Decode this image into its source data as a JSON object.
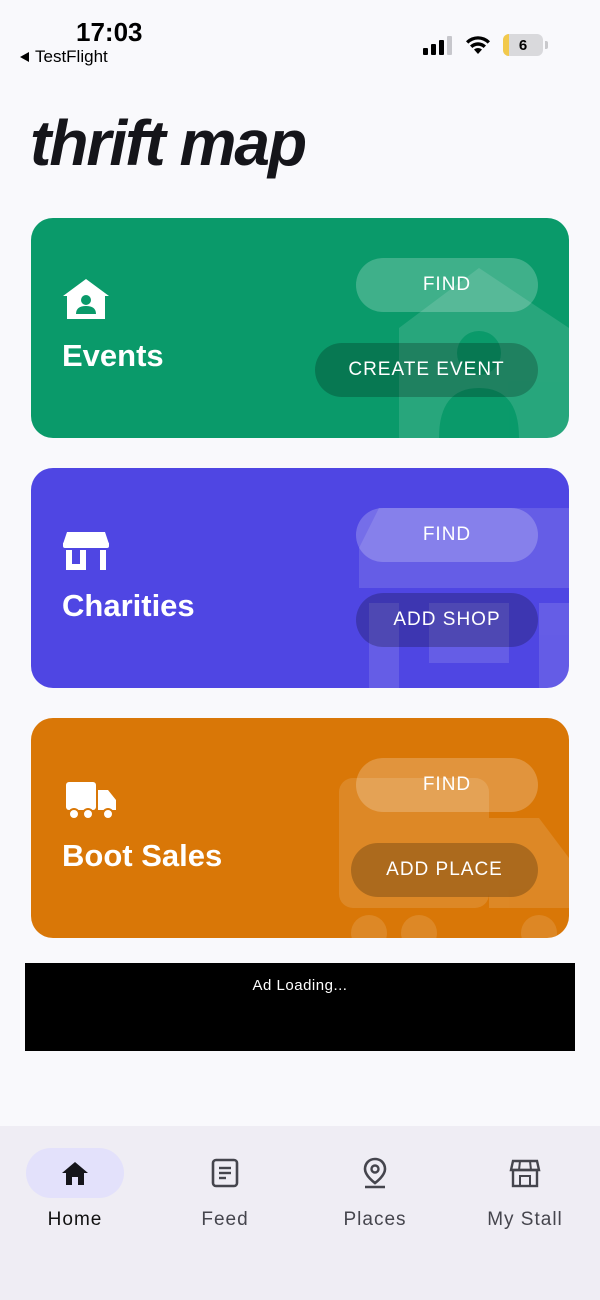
{
  "status": {
    "time": "17:03",
    "back_app": "TestFlight",
    "battery": "6"
  },
  "app_title": "thrift map",
  "cards": {
    "events": {
      "label": "Events",
      "find": "FIND",
      "action": "CREATE EVENT",
      "color": "#0a9a6a",
      "icon": "house-person-icon"
    },
    "charities": {
      "label": "Charities",
      "find": "FIND",
      "action": "ADD SHOP",
      "color": "#4f46e3",
      "icon": "storefront-icon"
    },
    "boot_sales": {
      "label": "Boot Sales",
      "find": "FIND",
      "action": "ADD PLACE",
      "color": "#d97707",
      "icon": "truck-icon"
    }
  },
  "ad": {
    "text": "Ad Loading..."
  },
  "nav": {
    "items": [
      {
        "label": "Home",
        "icon": "home-icon",
        "active": true
      },
      {
        "label": "Feed",
        "icon": "feed-icon",
        "active": false
      },
      {
        "label": "Places",
        "icon": "location-pin-icon",
        "active": false
      },
      {
        "label": "My Stall",
        "icon": "stall-icon",
        "active": false
      }
    ]
  }
}
